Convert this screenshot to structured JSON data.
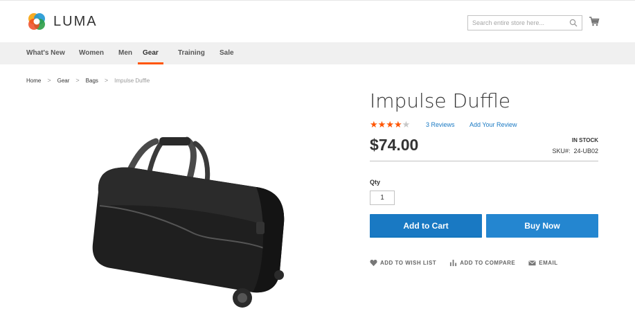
{
  "brand": {
    "name": "LUMA",
    "logo_icon": "luma-logo-icon"
  },
  "search": {
    "placeholder": "Search entire store here...",
    "icon": "search-icon"
  },
  "cart": {
    "icon": "cart-icon"
  },
  "nav": {
    "items": [
      {
        "label": "What's New",
        "active": false
      },
      {
        "label": "Women",
        "active": false
      },
      {
        "label": "Men",
        "active": false
      },
      {
        "label": "Gear",
        "active": true
      },
      {
        "label": "Training",
        "active": false
      },
      {
        "label": "Sale",
        "active": false
      }
    ]
  },
  "breadcrumb": {
    "items": [
      "Home",
      "Gear",
      "Bags"
    ],
    "current": "Impulse Duffle",
    "separator": ">"
  },
  "product": {
    "title": "Impulse Duffle",
    "rating": {
      "stars": 4,
      "out_of": 5,
      "reviews_label": "3 Reviews",
      "add_review_label": "Add Your Review"
    },
    "price": "$74.00",
    "stock": "IN STOCK",
    "sku_label": "SKU#:",
    "sku": "24-UB02",
    "image_icon": "duffle-bag-image"
  },
  "purchase": {
    "qty_label": "Qty",
    "qty_value": "1",
    "add_to_cart_label": "Add to Cart",
    "buy_now_label": "Buy Now"
  },
  "actions": {
    "wishlist_label": "ADD TO WISH LIST",
    "compare_label": "ADD TO COMPARE",
    "email_label": "EMAIL"
  },
  "colors": {
    "accent": "#1979c3",
    "nav_active": "#ff5501",
    "star": "#ff5501"
  }
}
